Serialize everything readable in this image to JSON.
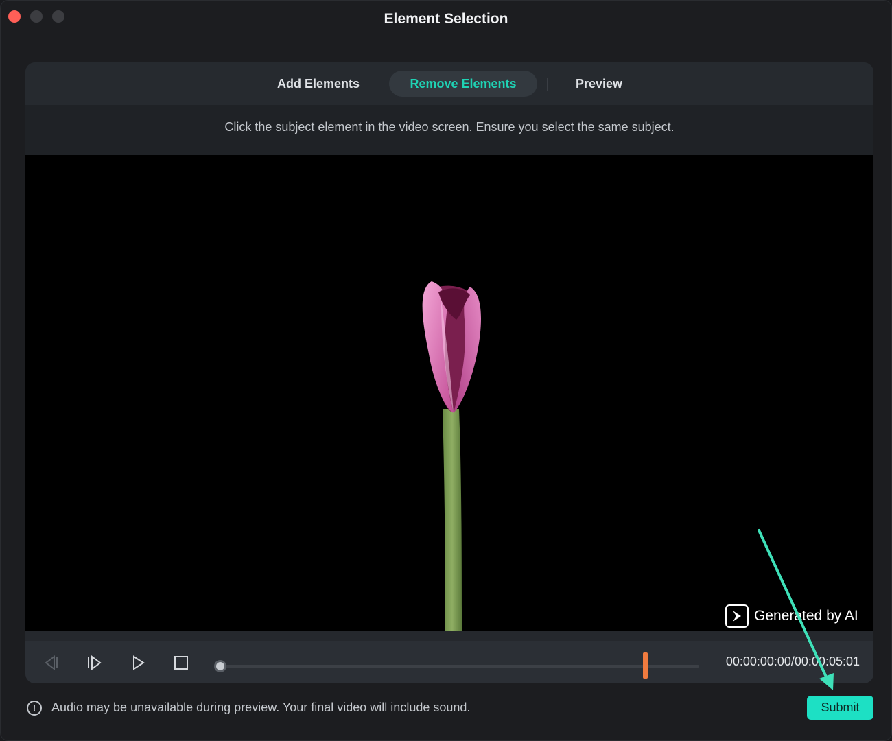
{
  "window": {
    "title": "Element Selection"
  },
  "tabs": [
    {
      "label": "Add Elements",
      "active": false
    },
    {
      "label": "Remove Elements",
      "active": true
    },
    {
      "label": "Preview",
      "active": false
    }
  ],
  "hint": "Click the subject element in the video screen. Ensure you select the same subject.",
  "video": {
    "badge_text": "Generated by AI",
    "badge_icon": "filmora-play-icon"
  },
  "player": {
    "timecode": "00:00:00:00/00:00:05:01",
    "playhead_fraction": 0.0,
    "marker_fraction": 0.887
  },
  "footer": {
    "note": "Audio may be unavailable during preview. Your final video will include sound.",
    "info_icon": "info-icon",
    "submit_label": "Submit"
  },
  "colors": {
    "accent": "#1de0c4",
    "active_tab_text": "#1fd2b4",
    "marker": "#f07b3f",
    "annotation_arrow": "#3ee0b8"
  }
}
